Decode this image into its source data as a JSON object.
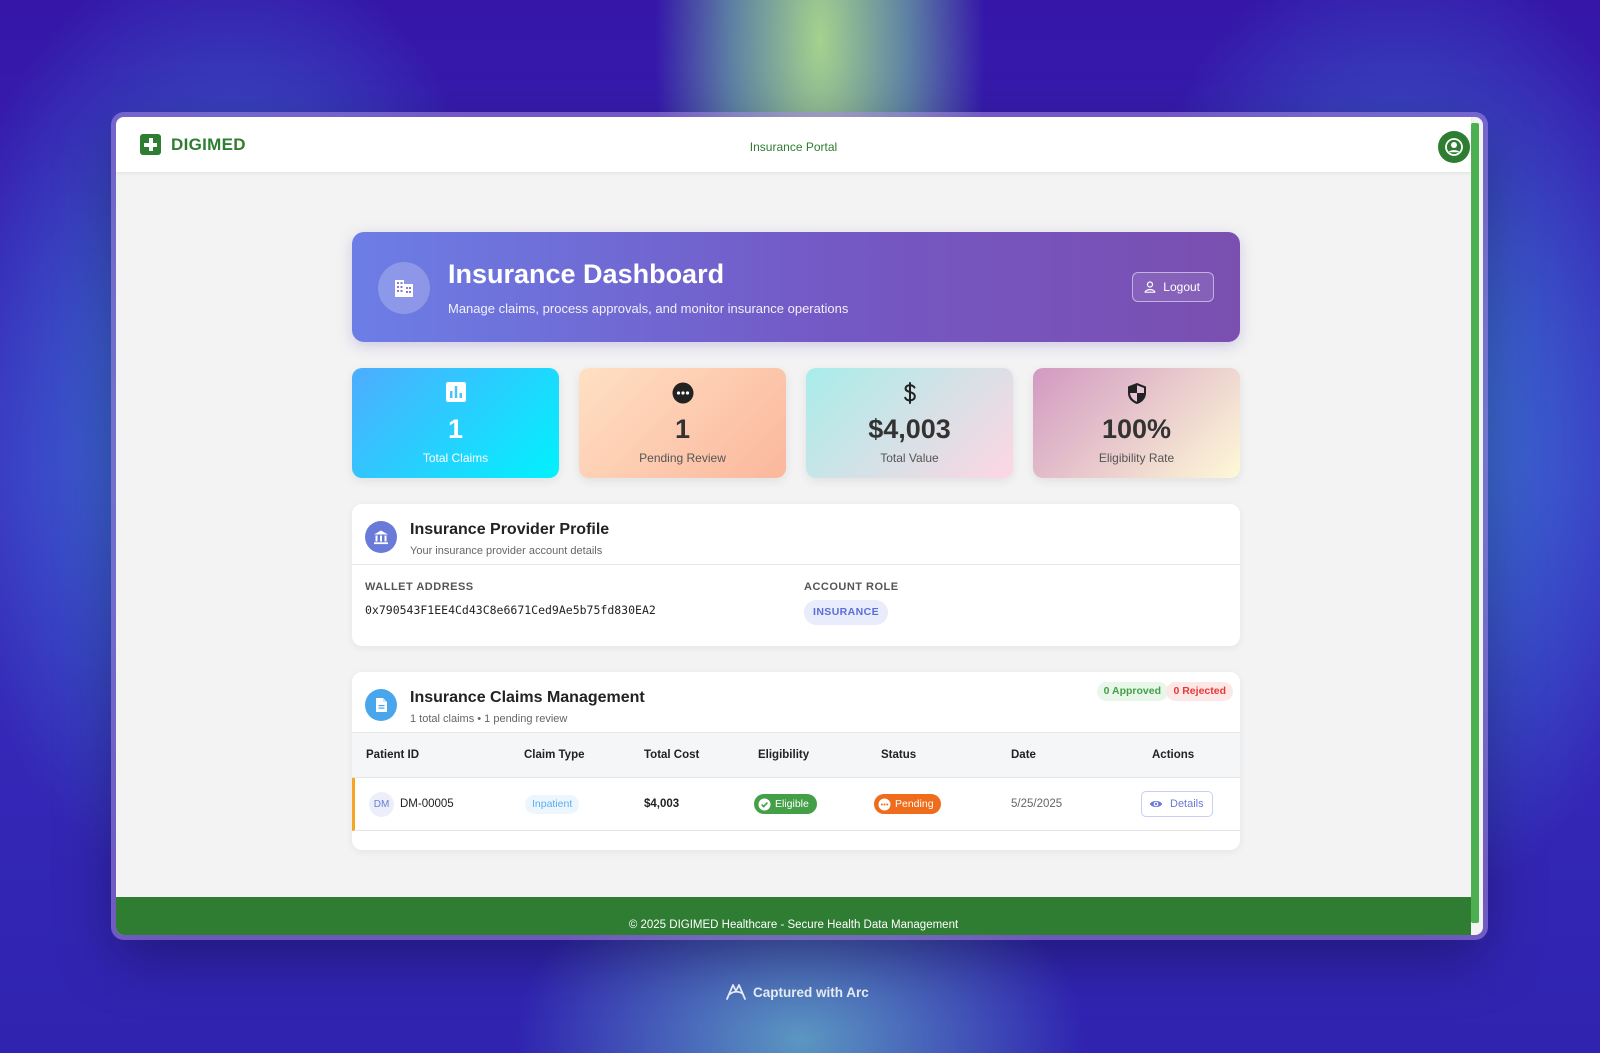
{
  "app": {
    "brand": "DIGIMED",
    "portal_label": "Insurance Portal",
    "footer": "© 2025 DIGIMED Healthcare - Secure Health Data Management"
  },
  "hero": {
    "title": "Insurance Dashboard",
    "subtitle": "Manage claims, process approvals, and monitor insurance operations",
    "logout_label": "Logout",
    "icon": "building-icon"
  },
  "stats": [
    {
      "value": "1",
      "label": "Total Claims",
      "icon": "bar-chart-icon"
    },
    {
      "value": "1",
      "label": "Pending Review",
      "icon": "more-horizontal-icon"
    },
    {
      "value": "$4,003",
      "label": "Total Value",
      "icon": "dollar-icon"
    },
    {
      "value": "100%",
      "label": "Eligibility Rate",
      "icon": "shield-icon"
    }
  ],
  "profile": {
    "title": "Insurance Provider Profile",
    "subtitle": "Your insurance provider account details",
    "wallet_label": "WALLET ADDRESS",
    "wallet_value": "0x790543F1EE4Cd43C8e6671Ced9Ae5b75fd830EA2",
    "role_label": "ACCOUNT ROLE",
    "role_value": "INSURANCE"
  },
  "claims": {
    "title": "Insurance Claims Management",
    "subtitle": "1 total claims • 1 pending review",
    "approved": "0 Approved",
    "rejected": "0 Rejected",
    "columns": [
      "Patient ID",
      "Claim Type",
      "Total Cost",
      "Eligibility",
      "Status",
      "Date",
      "Actions"
    ],
    "rows": [
      {
        "avatar": "DM",
        "patient_id": "DM-00005",
        "claim_type": "Inpatient",
        "total_cost": "$4,003",
        "eligibility": "Eligible",
        "status": "Pending",
        "date": "5/25/2025",
        "action": "Details"
      }
    ]
  },
  "capture": {
    "label": "Captured with Arc"
  },
  "colors": {
    "brand_green": "#2e7d32",
    "hero_start": "#6c7ee6",
    "hero_end": "#7a4fb0",
    "pending_orange": "#ee6c1b",
    "eligible_green": "#43a047"
  }
}
